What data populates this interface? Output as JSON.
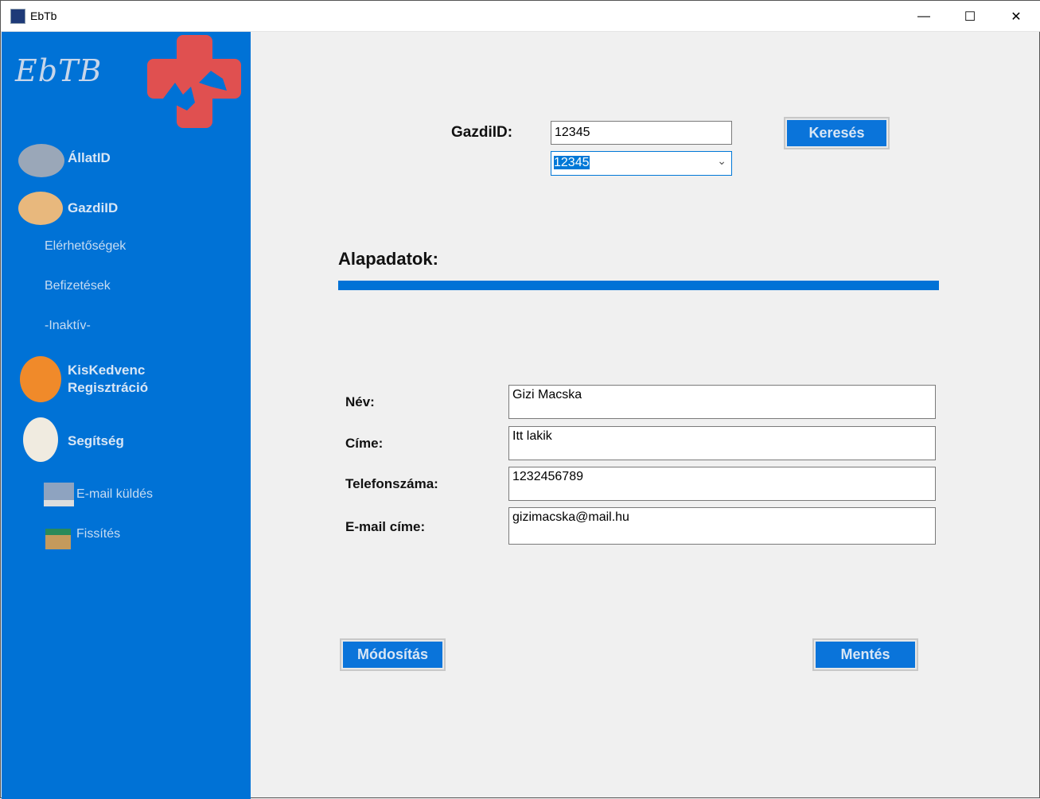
{
  "window": {
    "title": "EbTb",
    "minimize": "—",
    "maximize": "☐",
    "close": "✕"
  },
  "sidebar": {
    "logo_text": "EbTB",
    "items": [
      {
        "label": "ÁllatID",
        "icon": "grumpy-cat-icon"
      },
      {
        "label": "GazdiID",
        "icon": "pug-icon"
      },
      {
        "label": "Elérhetőségek"
      },
      {
        "label": "Befizetések"
      },
      {
        "label": "-Inaktív-"
      },
      {
        "label_line1": "KisKedvenc",
        "label_line2": "Regisztráció",
        "icon": "orange-cat-icon"
      },
      {
        "label": "Segítség",
        "icon": "fluffy-dog-icon"
      },
      {
        "label": "E-mail küldés",
        "icon": "laptop-cat-icon"
      },
      {
        "label": "Fissítés",
        "icon": "box-cat-icon"
      }
    ]
  },
  "search": {
    "label": "GazdiID:",
    "input_value": "12345",
    "combo_value": "12345",
    "button": "Keresés"
  },
  "section": {
    "title": "Alapadatok:"
  },
  "form": {
    "fields": [
      {
        "label": "Név:",
        "value": "Gizi Macska"
      },
      {
        "label": "Címe:",
        "value": "Itt lakik"
      },
      {
        "label": "Telefonszáma:",
        "value": "1232456789"
      },
      {
        "label": "E-mail címe:",
        "value": "gizimacska@mail.hu"
      }
    ],
    "modify_button": "Módosítás",
    "save_button": "Mentés"
  },
  "colors": {
    "accent": "#0072d6",
    "logo_cross": "#e05050"
  }
}
